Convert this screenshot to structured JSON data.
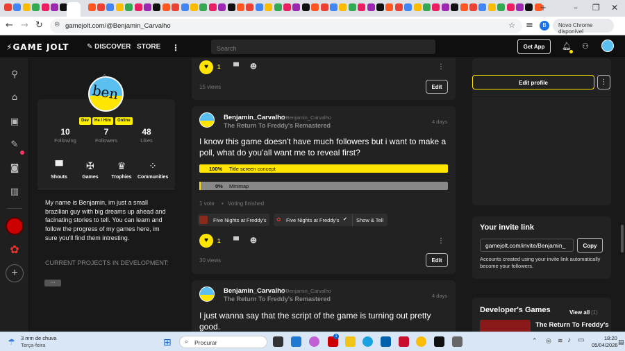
{
  "browser": {
    "url": "gamejolt.com/@Benjamin_Carvalho",
    "chrome_badge": "Novo Chrome disponível",
    "profile_initial": "B"
  },
  "topbar": {
    "logo": "GAME JOLT",
    "discover": "DISCOVER",
    "store": "STORE",
    "search_placeholder": "Search",
    "get_app": "Get App"
  },
  "profile": {
    "avatar_text": "ben",
    "tags": [
      "Dev",
      "He / Him",
      "Online"
    ],
    "stats": [
      {
        "num": "10",
        "label": "Following"
      },
      {
        "num": "7",
        "label": "Followers"
      },
      {
        "num": "48",
        "label": "Likes"
      }
    ],
    "quick_links": [
      "Shouts",
      "Games",
      "Trophies",
      "Communities"
    ],
    "bio": "My name is Benjamin, im just a small brazilian guy with big dreams up ahead and facinating stories to tell. You can learn and follow the progress of my games here, im sure you'll find them intresting.",
    "bio_projects": "CURRENT PROJECTS IN DEVELOPMENT:",
    "more": "···"
  },
  "feed": {
    "post0": {
      "likes": "1",
      "views": "15 views",
      "edit": "Edit"
    },
    "post1": {
      "author": "Benjamin_Carvalho",
      "handle": "@Benjamin_Carvalho",
      "game": "The Return To Freddy's Remastered",
      "time": "4 days",
      "text": "I know this game doesn't have much followers but i want to make a poll, what do you'all want me to reveal first?",
      "poll": [
        {
          "pct": "100%",
          "label": "Title screen concept",
          "fraction": 1.0
        },
        {
          "pct": "0%",
          "label": "Minimap",
          "fraction": 0.0
        }
      ],
      "vote_count": "1 vote",
      "vote_status": "Voting finished",
      "chip_community": "Five Nights at Freddy's",
      "chip_channel_community": "Five Nights at Freddy's",
      "chip_channel": "Show & Tell",
      "likes": "1",
      "views": "30 views",
      "edit": "Edit"
    },
    "post2": {
      "author": "Benjamin_Carvalho",
      "handle": "@Benjamin_Carvalho",
      "game": "The Return To Freddy's Remastered",
      "time": "4 days",
      "text": "I just wanna say that the script of the game is turning out pretty good."
    }
  },
  "right": {
    "edit_profile": "Edit profile",
    "invite_title": "Your invite link",
    "invite_link": "gamejolt.com/invite/Benjamin_",
    "copy": "Copy",
    "invite_desc": "Accounts created using your invite link automatically become your followers.",
    "dev_games_title": "Developer's Games",
    "view_all": "View all",
    "view_all_count": "(1)",
    "game_card_title": "The Return To Freddy's"
  },
  "taskbar": {
    "weather_temp": "3 mm de chuva",
    "weather_day": "Terça-feira",
    "search": "Procurar",
    "time": "18:20",
    "date": "05/04/2026",
    "badge_count": "1"
  },
  "colors": {
    "accent": "#ffe500",
    "bg": "#191919",
    "card": "#222222"
  }
}
